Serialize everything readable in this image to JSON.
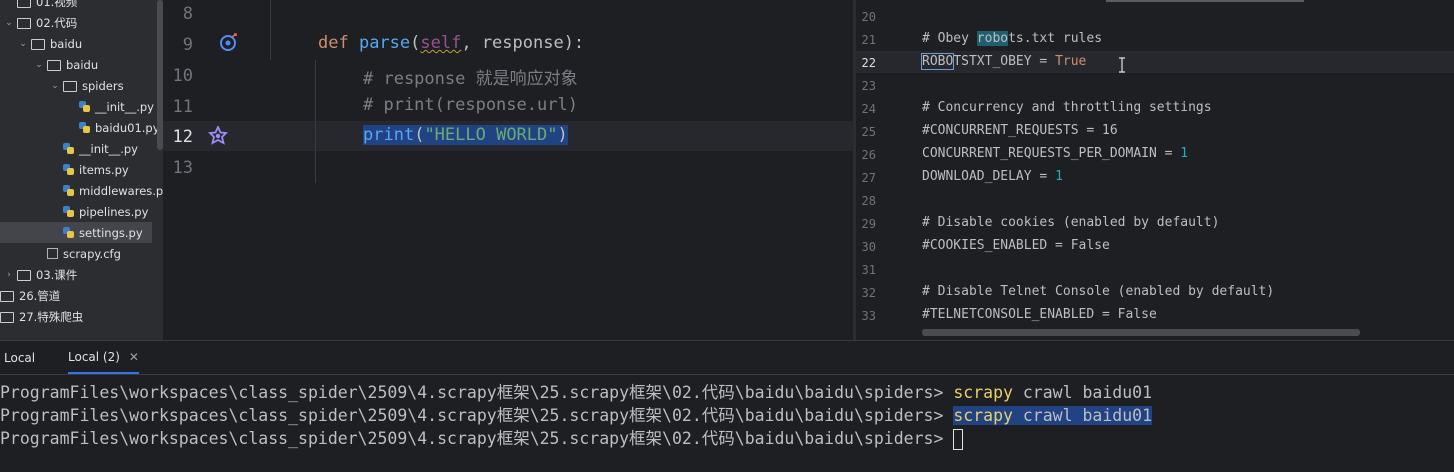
{
  "project_tree": [
    {
      "label": "01.视频",
      "kind": "folder",
      "level": 0,
      "chevron": ""
    },
    {
      "label": "02.代码",
      "kind": "folder",
      "level": 0,
      "chevron": "open"
    },
    {
      "label": "baidu",
      "kind": "folder",
      "level": 1,
      "chevron": "open"
    },
    {
      "label": "baidu",
      "kind": "folder",
      "level": 2,
      "chevron": "open"
    },
    {
      "label": "spiders",
      "kind": "folder",
      "level": 3,
      "chevron": "open"
    },
    {
      "label": "__init__.py",
      "kind": "py",
      "level": 4,
      "chevron": ""
    },
    {
      "label": "baidu01.py",
      "kind": "py",
      "level": 4,
      "chevron": ""
    },
    {
      "label": "__init__.py",
      "kind": "py",
      "level": 3,
      "chevron": ""
    },
    {
      "label": "items.py",
      "kind": "py",
      "level": 3,
      "chevron": ""
    },
    {
      "label": "middlewares.py",
      "kind": "py",
      "level": 3,
      "chevron": ""
    },
    {
      "label": "pipelines.py",
      "kind": "py",
      "level": 3,
      "chevron": ""
    },
    {
      "label": "settings.py",
      "kind": "py",
      "level": 3,
      "chevron": "",
      "selected": true
    },
    {
      "label": "scrapy.cfg",
      "kind": "cfg",
      "level": 2,
      "chevron": ""
    },
    {
      "label": "03.课件",
      "kind": "folder",
      "level": 0,
      "chevron": "closed"
    },
    {
      "label": "26.管道",
      "kind": "folder",
      "level": -1,
      "chevron": ""
    },
    {
      "label": "27.特殊爬虫",
      "kind": "folder",
      "level": -1,
      "chevron": ""
    }
  ],
  "left_editor": {
    "line_numbers": [
      "8",
      "9",
      "10",
      "11",
      "12",
      "13"
    ],
    "line_def": {
      "kw": "def ",
      "fn": "parse",
      "open": "(",
      "self": "self",
      "rest": ", response):"
    },
    "line_c1": "# response 就是响应对象",
    "line_c2": "# print(response.url)",
    "line_print": {
      "fn": "print",
      "open": "(",
      "str": "\"HELLO WORLD\"",
      "close": ")"
    }
  },
  "right_editor": {
    "line_numbers": [
      "20",
      "21",
      "22",
      "23",
      "24",
      "25",
      "26",
      "27",
      "28",
      "29",
      "30",
      "31",
      "32",
      "33"
    ],
    "l21_a": "# Obey ",
    "l21_hl": "robo",
    "l21_b": "ts.txt rules",
    "l22_box": "ROBO",
    "l22_rest": "TSTXT_OBEY = ",
    "l22_val": "True",
    "l24": "# Concurrency and throttling settings",
    "l25": "#CONCURRENT_REQUESTS = 16",
    "l26_a": "CONCURRENT_REQUESTS_PER_DOMAIN = ",
    "l26_v": "1",
    "l27_a": "DOWNLOAD_DELAY = ",
    "l27_v": "1",
    "l29": "# Disable cookies (enabled by default)",
    "l30": "#COOKIES_ENABLED = False",
    "l32": "# Disable Telnet Console (enabled by default)",
    "l33": "#TELNETCONSOLE_ENABLED = False"
  },
  "terminal": {
    "tabs": [
      {
        "label": "Local"
      },
      {
        "label": "Local (2)",
        "close": "✕"
      }
    ],
    "prompt": "ProgramFiles\\workspaces\\class_spider\\2509\\4.scrapy框架\\25.scrapy框架\\02.代码\\baidu\\baidu\\spiders>",
    "cmd_word": "scrapy",
    "cmd_rest": " crawl baidu01"
  },
  "colors": {
    "accent": "#3574f0",
    "selection": "#214283",
    "background": "#1e1f22"
  }
}
